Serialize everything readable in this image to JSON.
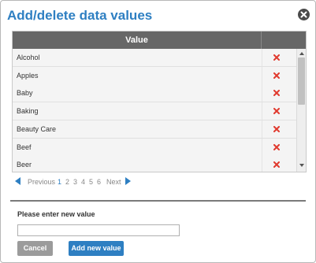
{
  "dialog": {
    "title": "Add/delete data values",
    "close_icon": "close-icon"
  },
  "table": {
    "header_value": "Value",
    "rows": [
      {
        "value": "Alcohol"
      },
      {
        "value": "Apples"
      },
      {
        "value": "Baby"
      },
      {
        "value": "Baking"
      },
      {
        "value": "Beauty Care"
      },
      {
        "value": "Beef"
      },
      {
        "value": "Beer"
      }
    ],
    "delete_icon": "delete-x-icon",
    "delete_color": "#e03a2e"
  },
  "pager": {
    "previous": "Previous",
    "pages": [
      "1",
      "2",
      "3",
      "4",
      "5",
      "6"
    ],
    "current": "1",
    "next": "Next"
  },
  "form": {
    "prompt": "Please enter new value",
    "input_value": "",
    "cancel_label": "Cancel",
    "add_label": "Add new value"
  },
  "colors": {
    "accent": "#2e7fc2",
    "header_bg": "#676767",
    "cancel_bg": "#9b9b9b"
  }
}
